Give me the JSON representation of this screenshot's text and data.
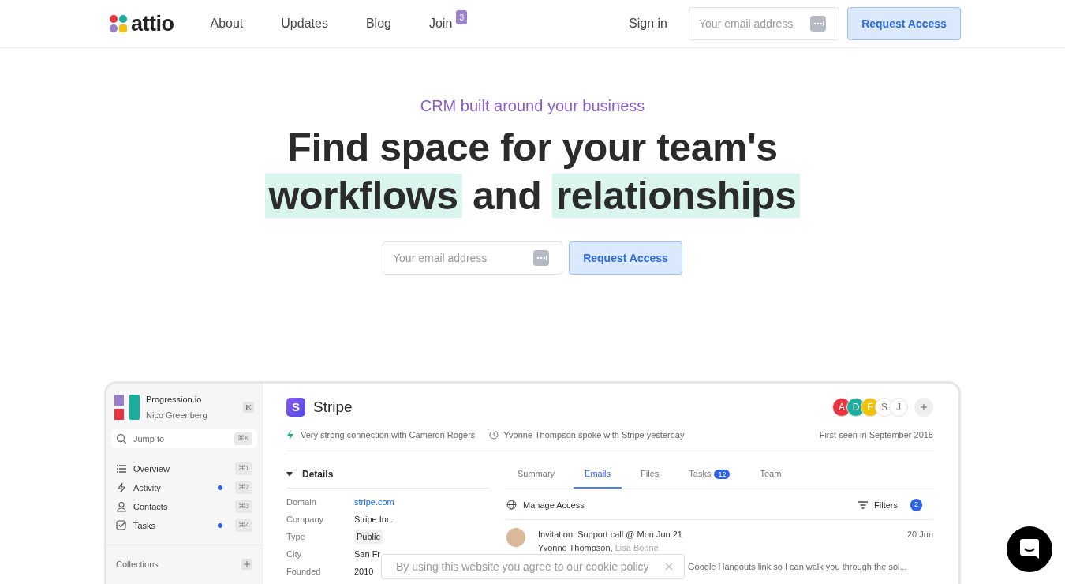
{
  "navbar": {
    "logo": "attio",
    "links": [
      {
        "label": "About"
      },
      {
        "label": "Updates"
      },
      {
        "label": "Blog"
      },
      {
        "label": "Join",
        "badge": "3"
      }
    ],
    "sign_in": "Sign in",
    "email": {
      "placeholder": "Your email address"
    },
    "button": "Request Access"
  },
  "hero": {
    "eyebrow": "CRM built around your business",
    "headline_lines": [
      [
        {
          "text": "Find space for your team's",
          "highlighted": false
        }
      ],
      [
        {
          "text": "workflows",
          "highlighted": true
        },
        {
          "text": " and ",
          "highlighted": false
        },
        {
          "text": "relationships",
          "highlighted": true
        }
      ]
    ],
    "email": {
      "placeholder": "Your email address"
    },
    "button": "Request Access"
  },
  "app": {
    "sidebar": {
      "workspace": "Progression.io",
      "user": "Nico Greenberg",
      "search": {
        "placeholder": "Jump to",
        "shortcut": "⌘K"
      },
      "items": [
        {
          "kind": "list",
          "label": "Overview",
          "unread": false,
          "shortcut": "⌘1"
        },
        {
          "kind": "bolt",
          "label": "Activity",
          "unread": true,
          "shortcut": "⌘2"
        },
        {
          "kind": "person",
          "label": "Contacts",
          "unread": false,
          "shortcut": "⌘3"
        },
        {
          "kind": "check",
          "label": "Tasks",
          "unread": true,
          "shortcut": "⌘4"
        }
      ],
      "collections": "Collections"
    },
    "record": {
      "title": "Stripe",
      "logo_letter": "S",
      "avatars": [
        {
          "initial": "A",
          "color": "#e8343f"
        },
        {
          "initial": "D",
          "color": "#1aae9f"
        },
        {
          "initial": "F",
          "color": "#f0c20a"
        },
        {
          "initial": "S",
          "color": "#ffffff"
        },
        {
          "initial": "J",
          "color": "#ffffff"
        }
      ],
      "connection": "Very strong connection with Cameron Rogers",
      "last_contact": "Yvonne Thompson spoke with Stripe yesterday",
      "first_seen": "First seen in September 2018",
      "details_title": "Details",
      "details_expanded": true,
      "fields": [
        {
          "label": "Domain",
          "value": "stripe.com",
          "kind": "link"
        },
        {
          "label": "Company",
          "value": "Stripe Inc.",
          "kind": "text"
        },
        {
          "label": "Type",
          "value": "Public",
          "kind": "tag"
        },
        {
          "label": "City",
          "value": "San Fr",
          "kind": "text"
        },
        {
          "label": "Founded",
          "value": "2010",
          "kind": "text"
        }
      ],
      "tabs": [
        {
          "label": "Summary",
          "selected": false
        },
        {
          "label": "Emails",
          "selected": true
        },
        {
          "label": "Files",
          "selected": false
        },
        {
          "label": "Tasks",
          "selected": false,
          "badge": "12"
        },
        {
          "label": "Team",
          "selected": false
        }
      ],
      "manage_access": "Manage Access",
      "filters": "Filters",
      "filters_count": "2",
      "emails": [
        {
          "subject": "Invitation: Support call @ Mon Jun 21",
          "from": "Yvonne Thompson,",
          "cc": "Lisa Boone",
          "date": "20 Jun",
          "preview": "Google Hangouts link so I can walk you through the sol..."
        }
      ]
    }
  },
  "cookie_banner": {
    "text": "By using this website you agree to our",
    "link": "cookie policy"
  }
}
